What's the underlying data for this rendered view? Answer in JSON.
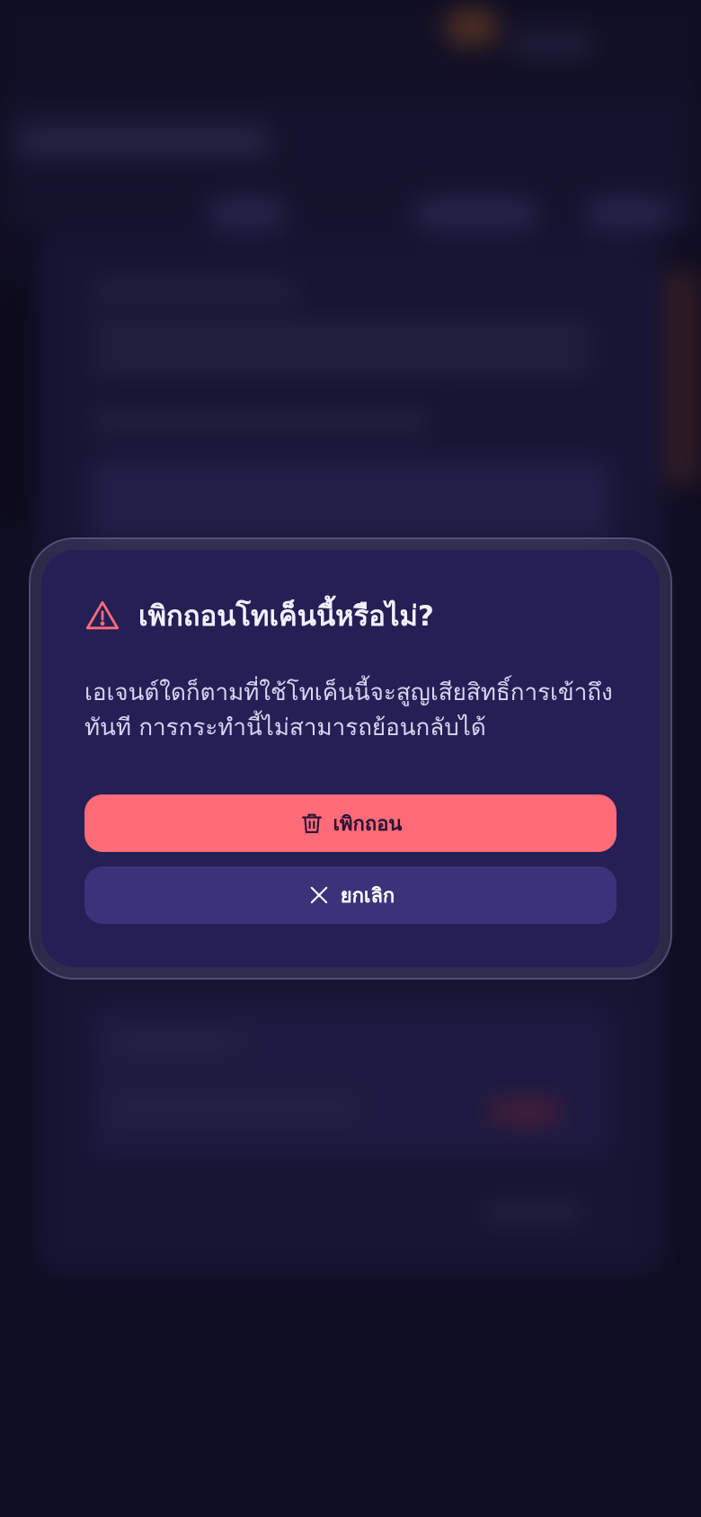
{
  "dialog": {
    "title": "เพิกถอนโทเค็นนี้หรือไม่?",
    "message": "เอเจนต์ใดก็ตามที่ใช้โทเค็นนี้จะสูญเสียสิทธิ์การเข้าถึงทันที การกระทำนี้ไม่สามารถย้อนกลับได้",
    "revoke_label": "เพิกถอน",
    "cancel_label": "ยกเลิก",
    "icons": {
      "warning": "warning-triangle-icon",
      "revoke": "trash-icon",
      "cancel": "close-icon"
    },
    "colors": {
      "accent_danger": "#ff6b77",
      "panel": "#241f54",
      "cancel_button": "#3a337a"
    }
  }
}
